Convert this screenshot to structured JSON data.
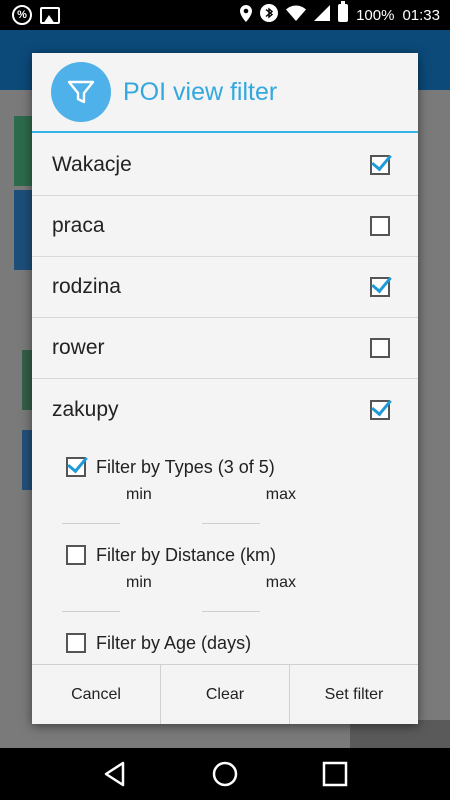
{
  "status_bar": {
    "battery": "100%",
    "time": "01:33",
    "icons": [
      "percent-icon",
      "image-icon",
      "location-icon",
      "bluetooth-icon",
      "wifi-icon",
      "signal-icon",
      "battery-icon"
    ]
  },
  "dialog": {
    "title": "POI view filter",
    "header_icon": "filter-icon",
    "categories": [
      {
        "label": "Wakacje",
        "checked": true
      },
      {
        "label": "praca",
        "checked": false
      },
      {
        "label": "rodzina",
        "checked": true
      },
      {
        "label": "rower",
        "checked": false
      },
      {
        "label": "zakupy",
        "checked": true
      }
    ],
    "filters": {
      "types": {
        "label": "Filter by Types (3 of 5)",
        "checked": true,
        "min_label": "min",
        "max_label": "max"
      },
      "distance": {
        "label": "Filter by Distance (km)",
        "checked": false,
        "min_label": "min",
        "max_label": "max"
      },
      "age": {
        "label": "Filter by Age (days)",
        "checked": false
      }
    },
    "buttons": {
      "cancel": "Cancel",
      "clear": "Clear",
      "set_filter": "Set filter"
    }
  },
  "colors": {
    "accent": "#33b5e5",
    "header_icon_bg": "#4fb1ea",
    "check": "#1f9ad6"
  },
  "nav_bar": {
    "icons": [
      "back-icon",
      "home-icon",
      "recents-icon"
    ]
  }
}
